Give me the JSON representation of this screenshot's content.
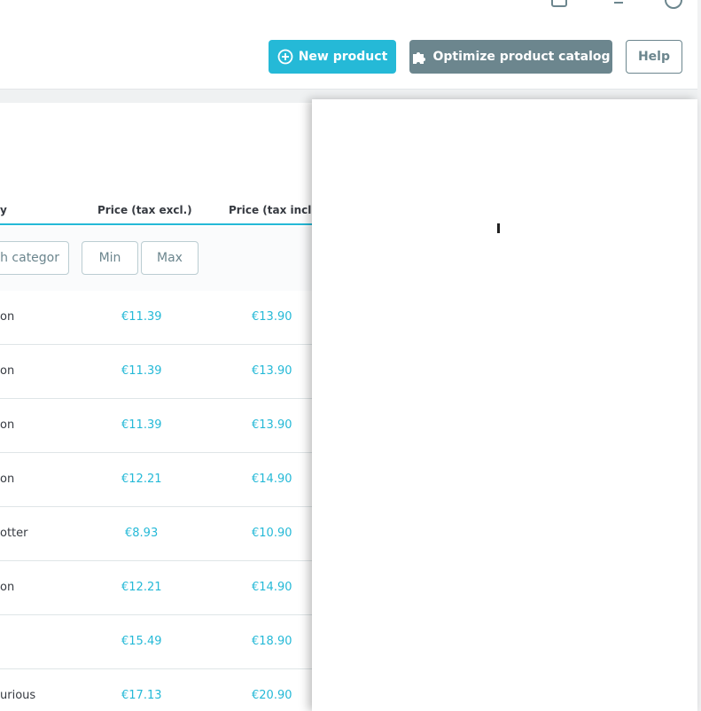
{
  "toolbar": {
    "new_product_label": "New product",
    "optimize_label": "Optimize product catalog",
    "help_label": "Help"
  },
  "table": {
    "columns": {
      "category": "y",
      "price_excl": "Price (tax excl.)",
      "price_incl": "Price (tax incl.)"
    },
    "filters": {
      "category_placeholder": "ch categor",
      "min_placeholder": "Min",
      "max_placeholder": "Max"
    },
    "rows": [
      {
        "category": "on",
        "price_excl": "€11.39",
        "price_incl": "€13.90"
      },
      {
        "category": "on",
        "price_excl": "€11.39",
        "price_incl": "€13.90"
      },
      {
        "category": "on",
        "price_excl": "€11.39",
        "price_incl": "€13.90"
      },
      {
        "category": "on",
        "price_excl": "€12.21",
        "price_incl": "€14.90"
      },
      {
        "category": "otter",
        "price_excl": "€8.93",
        "price_incl": "€10.90"
      },
      {
        "category": "on",
        "price_excl": "€12.21",
        "price_incl": "€14.90"
      },
      {
        "category": "",
        "price_excl": "€15.49",
        "price_incl": "€18.90"
      },
      {
        "category": "urious",
        "price_excl": "€17.13",
        "price_incl": "€20.90"
      }
    ]
  },
  "colors": {
    "primary": "#25b9d7",
    "secondary": "#6c868e",
    "text": "#363a41"
  },
  "icons": {
    "new_product": "plus-circle-icon",
    "optimize": "puzzle-icon"
  }
}
